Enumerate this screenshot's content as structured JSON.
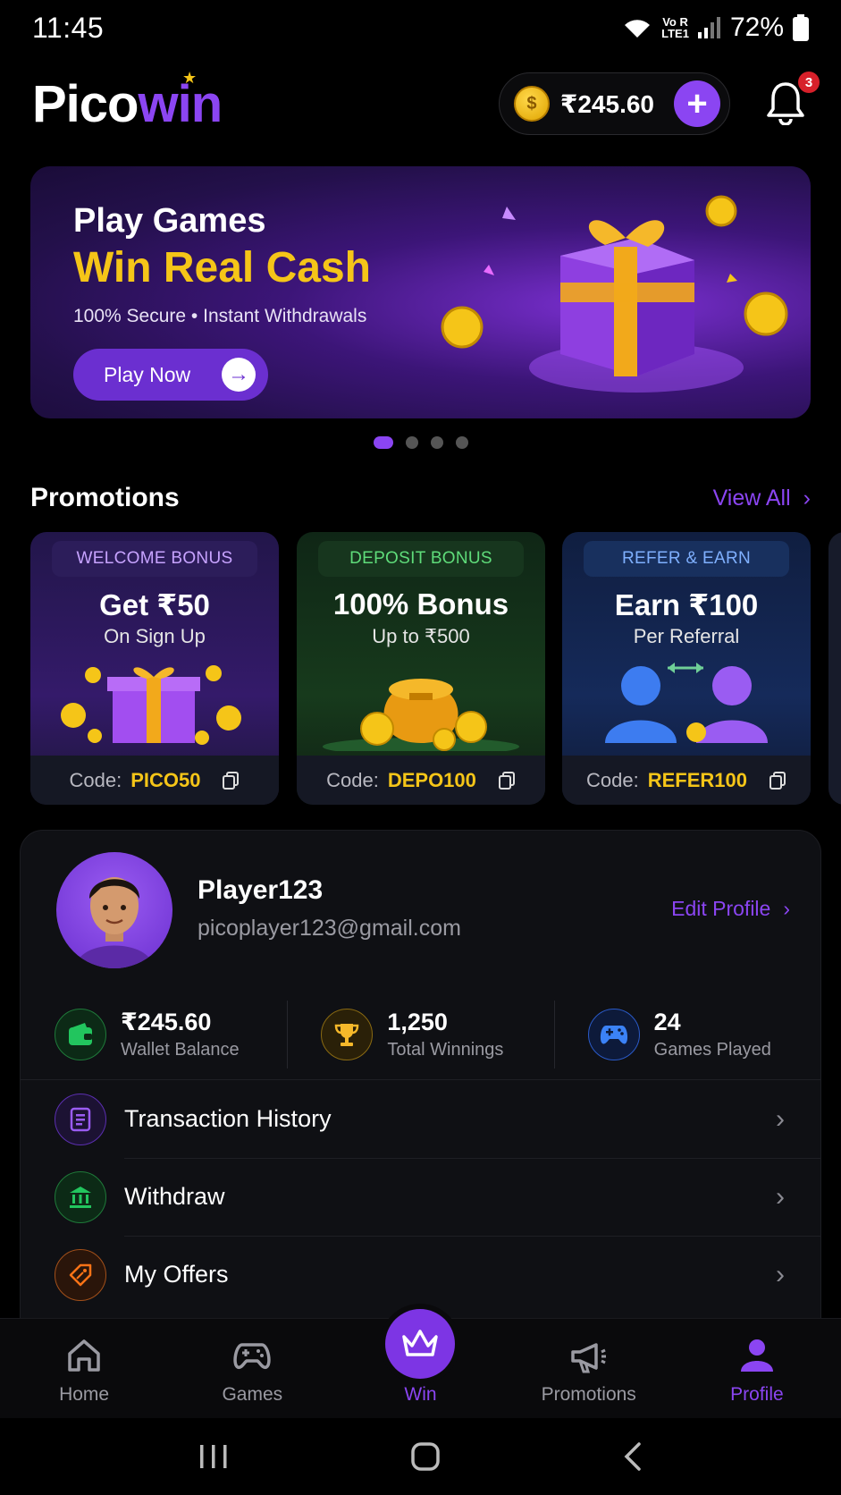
{
  "status_bar": {
    "time": "11:45",
    "battery": "72%",
    "network_line1": "Vo R",
    "network_line2": "LTE1"
  },
  "header": {
    "logo_part1": "Pico",
    "logo_part2": "win",
    "wallet_amount": "₹245.60",
    "notification_count": "3"
  },
  "banner": {
    "line1": "Play Games",
    "line2": "Win Real Cash",
    "line3": "100% Secure • Instant Withdrawals",
    "button_label": "Play Now"
  },
  "promotions": {
    "title": "Promotions",
    "view_all": "View All",
    "cards": [
      {
        "tag": "WELCOME BONUS",
        "headline": "Get ₹50",
        "sub": "On Sign Up",
        "code_label": "Code:",
        "code": "PICO50"
      },
      {
        "tag": "DEPOSIT BONUS",
        "headline": "100% Bonus",
        "sub": "Up to ₹500",
        "code_label": "Code:",
        "code": "DEPO100"
      },
      {
        "tag": "REFER & EARN",
        "headline": "Earn ₹100",
        "sub": "Per Referral",
        "code_label": "Code:",
        "code": "REFER100"
      }
    ]
  },
  "profile": {
    "name": "Player123",
    "email": "picoplayer123@gmail.com",
    "edit_label": "Edit Profile",
    "stats": [
      {
        "value": "₹245.60",
        "label": "Wallet Balance"
      },
      {
        "value": "1,250",
        "label": "Total Winnings"
      },
      {
        "value": "24",
        "label": "Games Played"
      }
    ],
    "menu": [
      {
        "label": "Transaction History"
      },
      {
        "label": "Withdraw"
      },
      {
        "label": "My Offers"
      }
    ]
  },
  "nav": {
    "items": [
      {
        "label": "Home"
      },
      {
        "label": "Games"
      },
      {
        "label": "Win"
      },
      {
        "label": "Promotions"
      },
      {
        "label": "Profile"
      }
    ]
  },
  "colors": {
    "accent": "#8b45f2",
    "gold": "#f5c518",
    "green": "#22c55e",
    "blue": "#3b82f6",
    "orange": "#f97316"
  }
}
